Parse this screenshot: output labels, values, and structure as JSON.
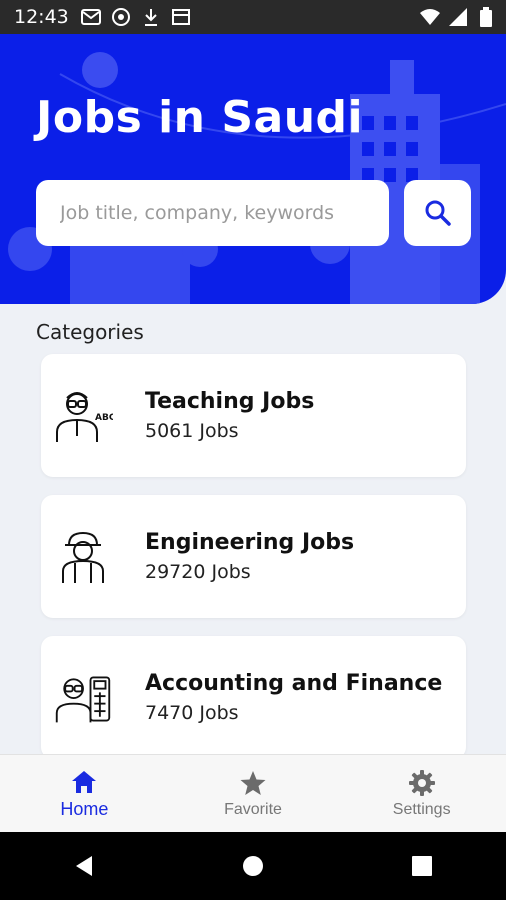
{
  "status_bar": {
    "time": "12:43",
    "left_icons": [
      "gmail-icon",
      "sync-icon",
      "download-icon",
      "calendar-icon"
    ],
    "right_icons": [
      "wifi-icon",
      "signal-icon",
      "battery-icon"
    ]
  },
  "header": {
    "title": "Jobs in Saudi",
    "background_color": "#0b1fe8"
  },
  "search": {
    "placeholder": "Job title, company, keywords",
    "button_icon": "search-icon"
  },
  "categories": {
    "title": "Categories",
    "items": [
      {
        "title": "Teaching Jobs",
        "count": "5061  Jobs",
        "icon": "teacher-icon"
      },
      {
        "title": "Engineering Jobs",
        "count": "29720  Jobs",
        "icon": "engineer-icon"
      },
      {
        "title": "Accounting and Finance",
        "count": "7470  Jobs",
        "icon": "accountant-icon"
      }
    ]
  },
  "bottom_nav": {
    "items": [
      {
        "label": "Home",
        "icon": "home-icon",
        "active": true
      },
      {
        "label": "Favorite",
        "icon": "star-icon",
        "active": false
      },
      {
        "label": "Settings",
        "icon": "gear-icon",
        "active": false
      }
    ],
    "active_color": "#1a2be0"
  },
  "system_nav": [
    "back-icon",
    "home-circle-icon",
    "recents-icon"
  ]
}
